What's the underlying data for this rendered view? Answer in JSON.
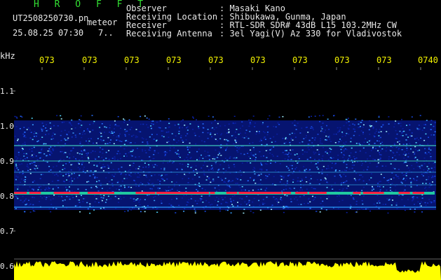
{
  "header": {
    "title": "H R O F F T",
    "file_name": "UT2508250730.pn",
    "detector": "meteor",
    "datetime": "25.08.25 07:30",
    "count": "7.."
  },
  "info": [
    {
      "label": "Observer",
      "value": ": Masaki Kano"
    },
    {
      "label": "Receiving Location",
      "value": ": Shibukawa, Gunma, Japan"
    },
    {
      "label": "Receiver",
      "value": ": RTL-SDR SDR# 43dB L15 103.2MHz CW"
    },
    {
      "label": "Receiving Antenna",
      "value": ": 3el Yagi(V) Az 330 for Vladivostok"
    }
  ],
  "axis": {
    "unit": "kHz",
    "time_ticks": [
      "073",
      "073",
      "073",
      "073",
      "073",
      "073",
      "073",
      "073",
      "073",
      "0740"
    ],
    "freq_ticks": [
      "1.1",
      "1.0",
      "0.9",
      "0.8",
      "0.7",
      "0.6"
    ]
  },
  "colors": {
    "background": "#000000",
    "noise": "#1030c0",
    "echo_line": "#30c8ff",
    "strong_signal": "#ff2040",
    "time_labels": "#f2f200",
    "title": "#33e033",
    "level_bar": "#ffff00"
  }
}
